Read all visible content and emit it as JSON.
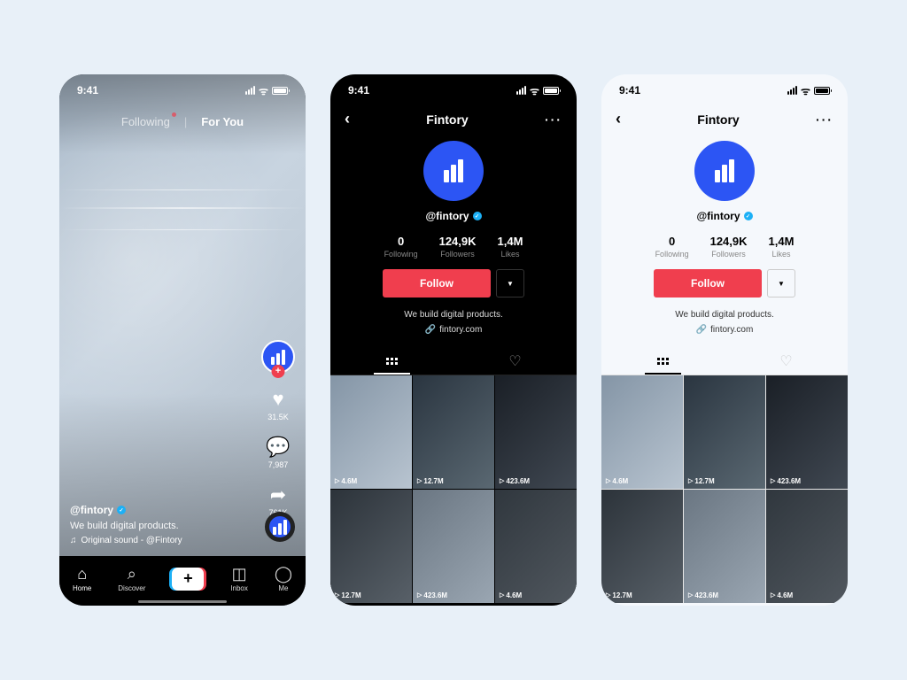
{
  "status": {
    "time": "9:41"
  },
  "feed": {
    "tabs": {
      "following": "Following",
      "for_you": "For You"
    },
    "handle": "@fintory",
    "bio": "We build digital products.",
    "sound": "Original sound - @Fintory",
    "rail": {
      "likes": "31.5K",
      "comments": "7,987",
      "shares": "761K"
    },
    "nav": {
      "home": "Home",
      "discover": "Discover",
      "inbox": "Inbox",
      "me": "Me"
    }
  },
  "profile": {
    "title": "Fintory",
    "handle": "@fintory",
    "stats": [
      {
        "num": "0",
        "lbl": "Following"
      },
      {
        "num": "124,9K",
        "lbl": "Followers"
      },
      {
        "num": "1,4M",
        "lbl": "Likes"
      }
    ],
    "follow": "Follow",
    "bio": "We build digital products.",
    "link": "fintory.com",
    "videos": [
      "4.6M",
      "12.7M",
      "423.6M",
      "12.7M",
      "423.6M",
      "4.6M"
    ]
  }
}
